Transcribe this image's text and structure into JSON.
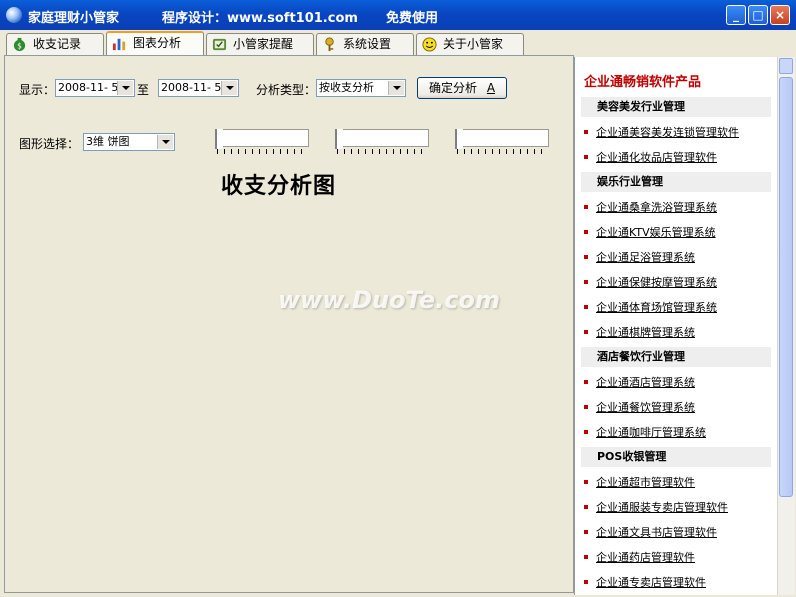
{
  "titlebar": {
    "app_name": "家庭理财小管家",
    "designer": "程序设计：www.soft101.com",
    "license": "免费使用",
    "minimize": "_",
    "maximize": "□",
    "close": "×"
  },
  "tabs": [
    {
      "label": "收支记录",
      "icon": "money-bag-icon"
    },
    {
      "label": "图表分析",
      "icon": "bar-chart-icon"
    },
    {
      "label": "小管家提醒",
      "icon": "reminder-icon"
    },
    {
      "label": "系统设置",
      "icon": "settings-icon"
    },
    {
      "label": "关于小管家",
      "icon": "smiley-icon"
    }
  ],
  "active_tab": 1,
  "filters": {
    "display_label": "显示：",
    "from_date": "2008-11- 5",
    "to_label": "至",
    "to_date": "2008-11- 5",
    "type_label": "分析类型：",
    "type_value": "按收支分析",
    "confirm_label": "确定分析",
    "confirm_accel": "A",
    "chart_label": "图形选择：",
    "chart_value": "3维 饼图"
  },
  "chart_title": "收支分析图",
  "watermark": "www.DuoTe.com",
  "sidebar": {
    "heading": "企业通畅销软件产品",
    "categories": [
      {
        "name": "美容美发行业管理",
        "items": [
          "企业通美容美发连锁管理软件",
          "企业通化妆品店管理软件"
        ]
      },
      {
        "name": "娱乐行业管理",
        "items": [
          "企业通桑拿洗浴管理系统",
          "企业通KTV娱乐管理系统",
          "企业通足浴管理系统",
          "企业通保健按摩管理系统",
          "企业通体育场馆管理系统",
          "企业通棋牌管理系统"
        ]
      },
      {
        "name": "酒店餐饮行业管理",
        "items": [
          "企业通酒店管理系统",
          "企业通餐饮管理系统",
          "企业通咖啡厅管理系统"
        ]
      },
      {
        "name": "POS收银管理",
        "items": [
          "企业通超市管理软件",
          "企业通服装专卖店管理软件",
          "企业通文具书店管理软件",
          "企业通药店管理软件",
          "企业通专卖店管理软件"
        ]
      }
    ]
  },
  "colors": {
    "titlebar": "#0a46c2",
    "tab_highlight": "#f0a020",
    "sidebar_heading": "#c00000",
    "bullet": "#c00000"
  }
}
